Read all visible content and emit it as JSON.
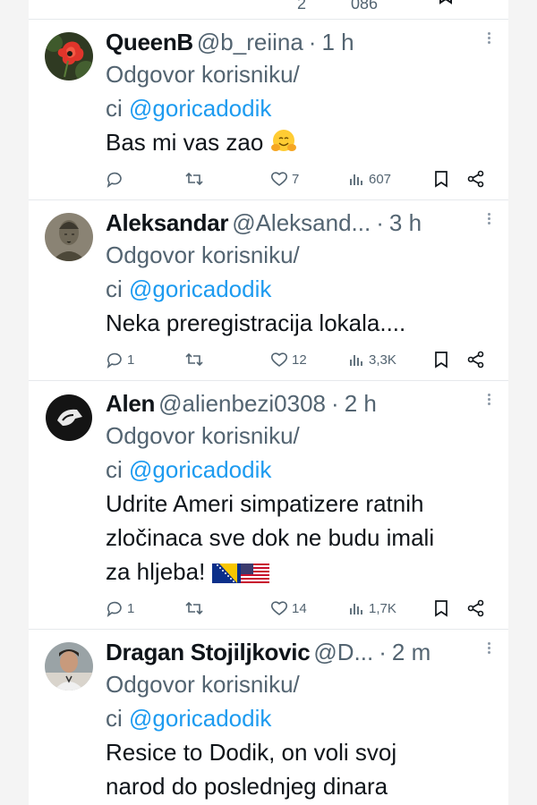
{
  "colors": {
    "accent": "#1d9bf0",
    "secondary": "#536471",
    "text": "#0f1419"
  },
  "top_stub": {
    "like_count": "2",
    "views_count": "086"
  },
  "tweets": [
    {
      "name": "QueenB",
      "handle": "@b_reiina",
      "dot": "·",
      "time": "1 h",
      "reply_prefix": "Odgovor korisniku/",
      "reply_prefix2": "ci",
      "mention": "@goricadodik",
      "text_lines": [
        "Bas mi vas zao"
      ],
      "emoji": "hugging-face",
      "reply_count": "",
      "like_count": "7",
      "views_count": "607",
      "avatar_icon": "red-poppy-flower"
    },
    {
      "name": "Aleksandar",
      "handle": "@Aleksand...",
      "dot": "·",
      "time": "3 h",
      "reply_prefix": "Odgovor korisniku/",
      "reply_prefix2": "ci",
      "mention": "@goricadodik",
      "text_lines": [
        "Neka preregistracija lokala...."
      ],
      "reply_count": "1",
      "like_count": "12",
      "views_count": "3,3K",
      "avatar_icon": "sketch-portrait"
    },
    {
      "name": "Alen",
      "handle": "@alienbezi0308",
      "dot": "·",
      "time": "2 h",
      "reply_prefix": "Odgovor korisniku/",
      "reply_prefix2": "ci",
      "mention": "@goricadodik",
      "text_lines": [
        "Udrite Ameri simpatizere ratnih",
        "zločinaca sve dok ne budu imali",
        "za hljeba!"
      ],
      "flags": [
        "bosnia-flag",
        "usa-flag"
      ],
      "reply_count": "1",
      "like_count": "14",
      "views_count": "1,7K",
      "avatar_icon": "dark-hand-logo"
    },
    {
      "name": "Dragan Stojiljkovic",
      "handle": "@D...",
      "dot": "·",
      "time": "2 m",
      "reply_prefix": "Odgovor korisniku/",
      "reply_prefix2": "ci",
      "mention": "@goricadodik",
      "text_lines": [
        "Resice to Dodik, on voli svoj",
        "narod do poslednjeg dinara"
      ],
      "avatar_icon": "man-photo"
    }
  ]
}
